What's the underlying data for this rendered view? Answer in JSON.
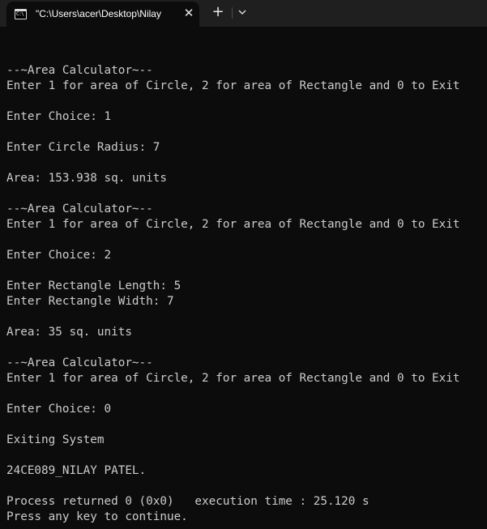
{
  "window": {
    "tab_title": "\"C:\\Users\\acer\\Desktop\\Nilay",
    "tab_icon_label": "C:\\",
    "close_glyph": "✕",
    "new_tab_glyph": "+",
    "tab_icon": "console-icon",
    "dropdown_icon": "chevron-down-icon"
  },
  "colors": {
    "background": "#0c0c0c",
    "titlebar": "#1f1f1f",
    "text": "#cccccc"
  },
  "console": {
    "lines": [
      "--~Area Calculator~--",
      "Enter 1 for area of Circle, 2 for area of Rectangle and 0 to Exit",
      "",
      "Enter Choice: 1",
      "",
      "Enter Circle Radius: 7",
      "",
      "Area: 153.938 sq. units",
      "",
      "--~Area Calculator~--",
      "Enter 1 for area of Circle, 2 for area of Rectangle and 0 to Exit",
      "",
      "Enter Choice: 2",
      "",
      "Enter Rectangle Length: 5",
      "Enter Rectangle Width: 7",
      "",
      "Area: 35 sq. units",
      "",
      "--~Area Calculator~--",
      "Enter 1 for area of Circle, 2 for area of Rectangle and 0 to Exit",
      "",
      "Enter Choice: 0",
      "",
      "Exiting System",
      "",
      "24CE089_NILAY PATEL.",
      "",
      "Process returned 0 (0x0)   execution time : 25.120 s",
      "Press any key to continue."
    ]
  }
}
